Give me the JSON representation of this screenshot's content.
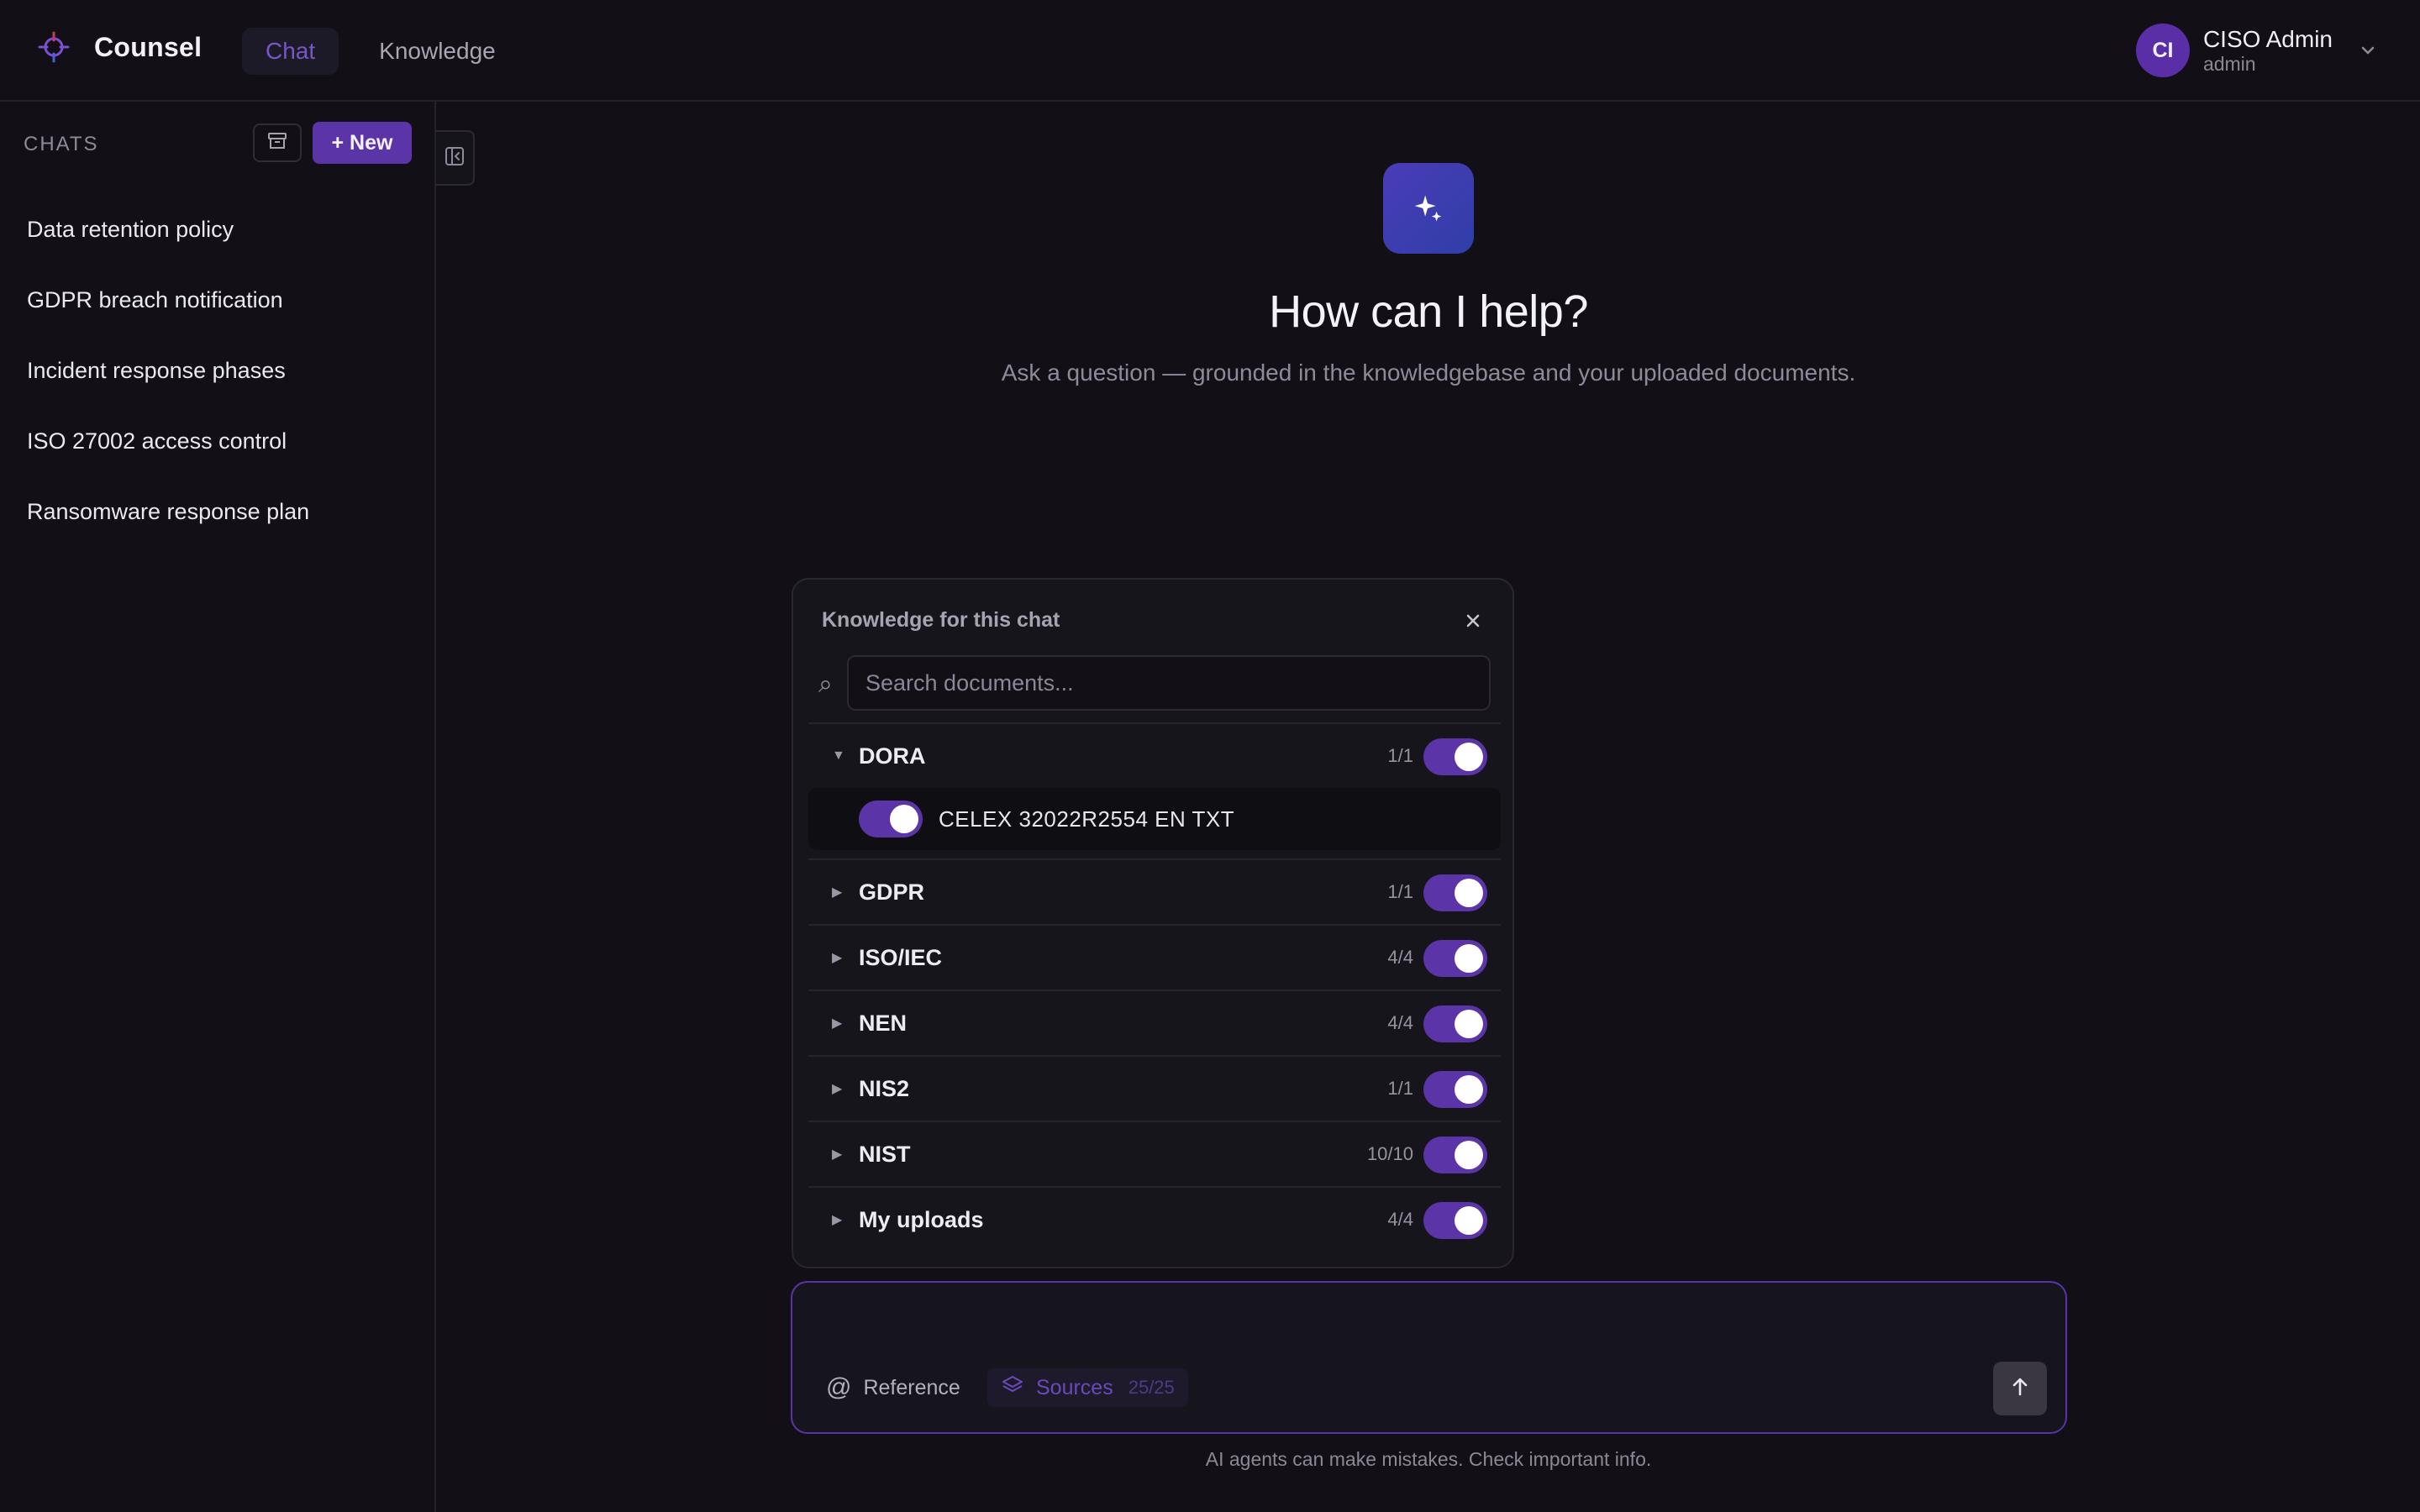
{
  "app": {
    "name": "Counsel",
    "accent_color": "#5b34a8"
  },
  "nav": {
    "tabs": [
      {
        "label": "Chat",
        "active": true
      },
      {
        "label": "Knowledge",
        "active": false
      }
    ]
  },
  "user": {
    "initials": "CI",
    "name": "CISO Admin",
    "role": "admin"
  },
  "sidebar": {
    "title": "CHATS",
    "new_button": "+ New",
    "chats": [
      "Data retention policy",
      "GDPR breach notification",
      "Incident response phases",
      "ISO 27002 access control",
      "Ransomware response plan"
    ]
  },
  "hero": {
    "title": "How can I help?",
    "subtitle": "Ask a question — grounded in the knowledgebase and your uploaded documents."
  },
  "knowledge_panel": {
    "title": "Knowledge for this chat",
    "search_placeholder": "Search documents...",
    "groups": [
      {
        "name": "DORA",
        "count": "1/1",
        "expanded": true,
        "enabled": true,
        "documents": [
          {
            "name": "CELEX 32022R2554 EN TXT",
            "enabled": true
          }
        ]
      },
      {
        "name": "GDPR",
        "count": "1/1",
        "expanded": false,
        "enabled": true
      },
      {
        "name": "ISO/IEC",
        "count": "4/4",
        "expanded": false,
        "enabled": true
      },
      {
        "name": "NEN",
        "count": "4/4",
        "expanded": false,
        "enabled": true
      },
      {
        "name": "NIS2",
        "count": "1/1",
        "expanded": false,
        "enabled": true
      },
      {
        "name": "NIST",
        "count": "10/10",
        "expanded": false,
        "enabled": true
      },
      {
        "name": "My uploads",
        "count": "4/4",
        "expanded": false,
        "enabled": true
      }
    ]
  },
  "composer": {
    "reference_label": "Reference",
    "sources_label": "Sources",
    "sources_count": "25/25"
  },
  "disclaimer": "AI agents can make mistakes. Check important info."
}
